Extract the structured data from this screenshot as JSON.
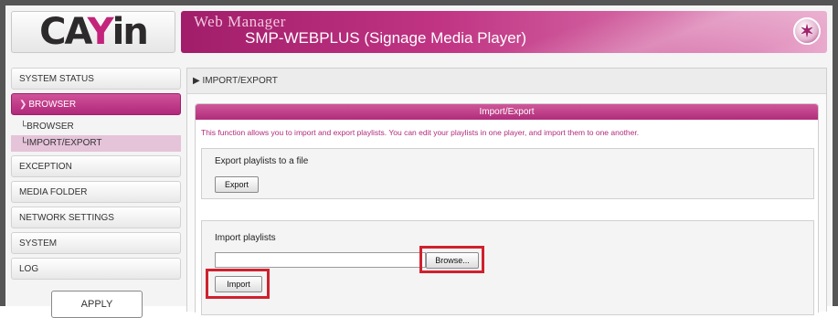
{
  "header": {
    "logo_prefix": "CA",
    "logo_mark": "Y",
    "logo_suffix": "in",
    "subtitle": "Web Manager",
    "title": "SMP-WEBPLUS (Signage Media Player)",
    "icon": "wizard-star-icon"
  },
  "sidebar": {
    "items": [
      {
        "label": "SYSTEM STATUS"
      },
      {
        "label": "BROWSER"
      },
      {
        "label": "EXCEPTION"
      },
      {
        "label": "MEDIA FOLDER"
      },
      {
        "label": "NETWORK SETTINGS"
      },
      {
        "label": "SYSTEM"
      },
      {
        "label": "LOG"
      }
    ],
    "sub_items": [
      {
        "label": "BROWSER"
      },
      {
        "label": "IMPORT/EXPORT"
      }
    ],
    "bottom_button": "APPLY"
  },
  "main": {
    "breadcrumb": "IMPORT/EXPORT",
    "panel_title": "Import/Export",
    "description": "This function allows you to import and export playlists. You can edit your playlists in one player, and import them to one another.",
    "export_section": {
      "label": "Export playlists to a file",
      "button": "Export"
    },
    "import_section": {
      "label": "Import playlists",
      "file_value": "",
      "browse_button": "Browse...",
      "import_button": "Import"
    }
  },
  "colors": {
    "accent": "#b02c7b",
    "highlight": "#d0212d"
  }
}
